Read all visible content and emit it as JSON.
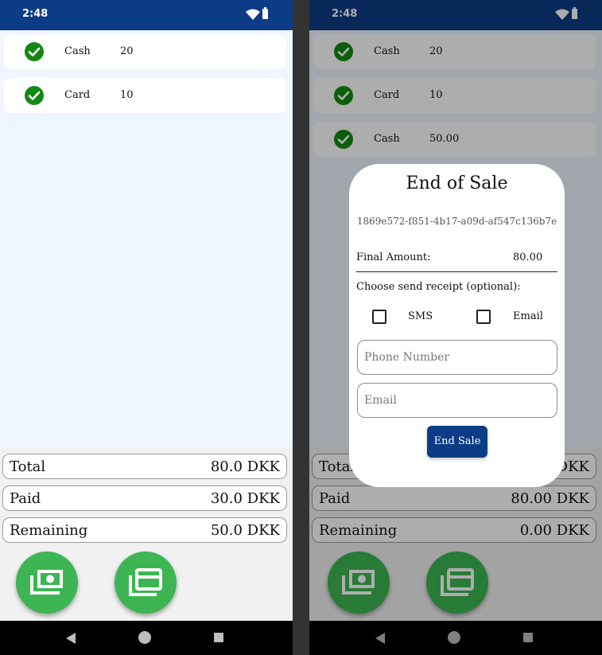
{
  "status": {
    "time": "2:48"
  },
  "left": {
    "payments": [
      {
        "type": "Cash",
        "amount": "20"
      },
      {
        "type": "Card",
        "amount": "10"
      }
    ],
    "summary": {
      "total_label": "Total",
      "total_value": "80.0  DKK",
      "paid_label": "Paid",
      "paid_value": "30.0  DKK",
      "remaining_label": "Remaining",
      "remaining_value": "50.0  DKK"
    }
  },
  "right": {
    "payments": [
      {
        "type": "Cash",
        "amount": "20"
      },
      {
        "type": "Card",
        "amount": "10"
      },
      {
        "type": "Cash",
        "amount": "50.00"
      }
    ],
    "summary": {
      "total_label": "Total",
      "total_value": "DKK",
      "paid_label": "Paid",
      "paid_value": "80.00  DKK",
      "remaining_label": "Remaining",
      "remaining_value": "0.00  DKK"
    },
    "dialog": {
      "title": "End of Sale",
      "transaction_id": "1869e572-f851-4b17-a09d-af547c136b7e",
      "final_amount_label": "Final Amount:",
      "final_amount_value": "80.00",
      "receipt_prompt": "Choose send receipt (optional):",
      "sms_label": "SMS",
      "email_label": "Email",
      "phone_placeholder": "Phone Number",
      "email_placeholder": "Email",
      "end_sale_label": "End Sale"
    }
  },
  "icons": {
    "payment_row": "check-circle-icon",
    "fab_cash": "cash-icon",
    "fab_card": "cards-icon"
  },
  "colors": {
    "status_bar": "#0c3c85",
    "accent_green": "#3db553",
    "check_green": "#128a12",
    "primary_button": "#0c3c85",
    "list_background": "#eff6ff"
  }
}
